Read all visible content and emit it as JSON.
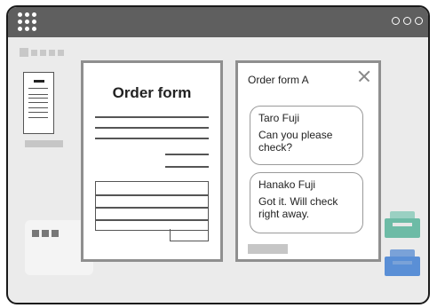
{
  "order_form": {
    "title": "Order form"
  },
  "chat": {
    "title": "Order form A",
    "messages": [
      {
        "name": "Taro Fuji",
        "text": "Can you please check?"
      },
      {
        "name": "Hanako Fuji",
        "text": "Got it. Will check right away."
      }
    ]
  },
  "colors": {
    "titlebar": "#5f5f5f",
    "panel_border": "#8f8f8f",
    "tray_green": "#6dbba6",
    "tray_blue": "#5a8fd6"
  },
  "icons": [
    "app-grid-icon",
    "window-controls-icon",
    "close-icon",
    "document-icon",
    "tray-icon"
  ]
}
